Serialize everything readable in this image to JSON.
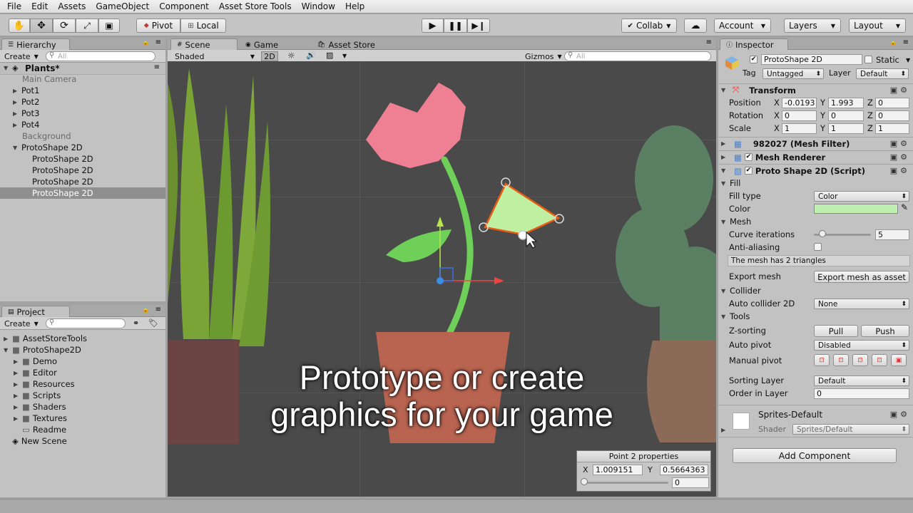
{
  "menu": [
    "File",
    "Edit",
    "Assets",
    "GameObject",
    "Component",
    "Asset Store Tools",
    "Window",
    "Help"
  ],
  "toolbar": {
    "pivot_label": "Pivot",
    "local_label": "Local",
    "collab_label": "Collab",
    "account_label": "Account",
    "layers_label": "Layers",
    "layout_label": "Layout"
  },
  "hierarchy": {
    "tab": "Hierarchy",
    "create": "Create",
    "search_placeholder": "All",
    "scene_name": "Plants*",
    "items": [
      {
        "label": "Main Camera"
      },
      {
        "label": "Pot1"
      },
      {
        "label": "Pot2"
      },
      {
        "label": "Pot3"
      },
      {
        "label": "Pot4"
      },
      {
        "label": "Background"
      },
      {
        "label": "ProtoShape 2D"
      },
      {
        "label": "ProtoShape 2D"
      },
      {
        "label": "ProtoShape 2D"
      },
      {
        "label": "ProtoShape 2D"
      },
      {
        "label": "ProtoShape 2D"
      }
    ]
  },
  "project": {
    "tab": "Project",
    "create": "Create",
    "items": [
      {
        "label": "AssetStoreTools"
      },
      {
        "label": "ProtoShape2D"
      },
      {
        "label": "Demo"
      },
      {
        "label": "Editor"
      },
      {
        "label": "Resources"
      },
      {
        "label": "Scripts"
      },
      {
        "label": "Shaders"
      },
      {
        "label": "Textures"
      },
      {
        "label": "Readme"
      },
      {
        "label": "New Scene"
      }
    ]
  },
  "scene": {
    "tabs": [
      "Scene",
      "Game",
      "Asset Store"
    ],
    "shading": "Shaded",
    "mode_2d": "2D",
    "gizmos": "Gizmos",
    "search_placeholder": "All",
    "overlay_line1": "Prototype or create",
    "overlay_line2": "graphics for your game",
    "point_panel": {
      "title": "Point 2 properties",
      "x_label": "X",
      "x_value": "1.009151",
      "y_label": "Y",
      "y_value": "0.5664363",
      "slider_value": "0"
    }
  },
  "inspector": {
    "tab": "Inspector",
    "object_name": "ProtoShape 2D",
    "static_label": "Static",
    "tag_label": "Tag",
    "tag_value": "Untagged",
    "layer_label": "Layer",
    "layer_value": "Default",
    "transform": {
      "title": "Transform",
      "position_label": "Position",
      "rotation_label": "Rotation",
      "scale_label": "Scale",
      "position": {
        "x": "-0.0193",
        "y": "1.993",
        "z": "0"
      },
      "rotation": {
        "x": "0",
        "y": "0",
        "z": "0"
      },
      "scale": {
        "x": "1",
        "y": "1",
        "z": "1"
      }
    },
    "mesh_filter_title": "982027 (Mesh Filter)",
    "mesh_renderer_title": "Mesh Renderer",
    "script_title": "Proto Shape 2D (Script)",
    "fill_section": "Fill",
    "fill_type_label": "Fill type",
    "fill_type_value": "Color",
    "color_label": "Color",
    "color_value": "#bff0b0",
    "mesh_section": "Mesh",
    "curve_iterations_label": "Curve iterations",
    "curve_iterations_value": "5",
    "curve_iterations_fraction": 0.15,
    "anti_aliasing_label": "Anti-aliasing",
    "mesh_info": "The mesh has 2 triangles",
    "export_mesh_label": "Export mesh",
    "export_mesh_button": "Export mesh as asset",
    "collider_section": "Collider",
    "auto_collider_label": "Auto collider 2D",
    "auto_collider_value": "None",
    "tools_section": "Tools",
    "z_sorting_label": "Z-sorting",
    "pull_button": "Pull",
    "push_button": "Push",
    "auto_pivot_label": "Auto pivot",
    "auto_pivot_value": "Disabled",
    "manual_pivot_label": "Manual pivot",
    "sorting_layer_label": "Sorting Layer",
    "sorting_layer_value": "Default",
    "order_in_layer_label": "Order in Layer",
    "order_in_layer_value": "0",
    "material_name": "Sprites-Default",
    "shader_label": "Shader",
    "shader_value": "Sprites/Default",
    "add_component": "Add Component"
  }
}
